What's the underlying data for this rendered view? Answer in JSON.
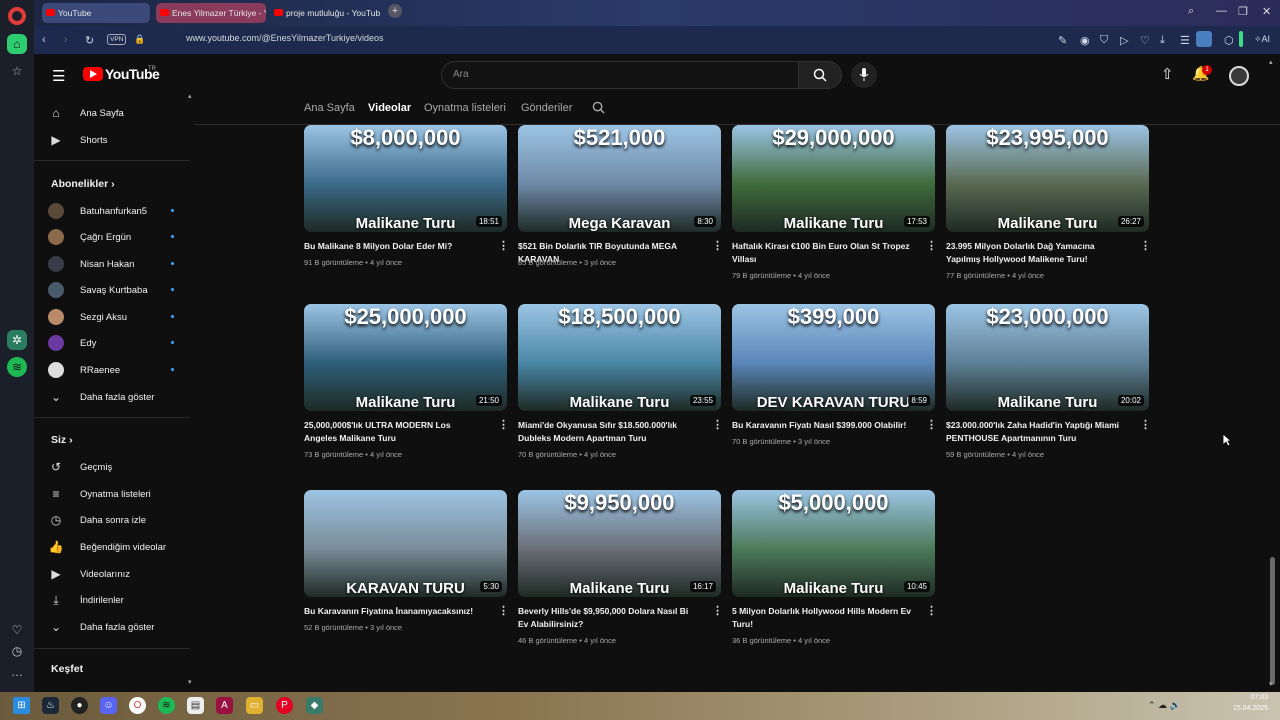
{
  "browser": {
    "tabs": [
      {
        "label": "YouTube",
        "active": true
      },
      {
        "label": "Enes Yilmazer Türkiye - Yo"
      },
      {
        "label": "proje mutluluğu - YouTub"
      }
    ],
    "url": "www.youtube.com/@EnesYilmazerTurkiye/videos",
    "vpn_label": "VPN",
    "ai_label": "AI"
  },
  "header": {
    "logo_text": "YouTube",
    "logo_region": "TR",
    "search_placeholder": "Ara",
    "notification_count": "1"
  },
  "sidebar": {
    "main": [
      {
        "label": "Ana Sayfa",
        "icon": "home-icon"
      },
      {
        "label": "Shorts",
        "icon": "shorts-icon"
      }
    ],
    "subscriptions_title": "Abonelikler",
    "subscriptions": [
      {
        "label": "Batuhanfurkan5"
      },
      {
        "label": "Çağrı Ergün"
      },
      {
        "label": "Nisan Hakan"
      },
      {
        "label": "Savaş Kurtbaba"
      },
      {
        "label": "Sezgi Aksu"
      },
      {
        "label": "Edy"
      },
      {
        "label": "RRaenee"
      }
    ],
    "show_more_1": "Daha fazla göster",
    "you_title": "Siz",
    "you": [
      {
        "label": "Geçmiş",
        "icon": "history-icon"
      },
      {
        "label": "Oynatma listeleri",
        "icon": "playlist-icon"
      },
      {
        "label": "Daha sonra izle",
        "icon": "clock-icon"
      },
      {
        "label": "Beğendiğim videolar",
        "icon": "thumbs-up-icon"
      },
      {
        "label": "Videolarınız",
        "icon": "video-icon"
      },
      {
        "label": "İndirilenler",
        "icon": "download-icon"
      }
    ],
    "show_more_2": "Daha fazla göster",
    "explore_title": "Keşfet"
  },
  "channel_tabs": [
    "Ana Sayfa",
    "Videolar",
    "Oynatma listeleri",
    "Gönderiler"
  ],
  "videos": [
    {
      "price": "$8,000,000",
      "tag": "Malikane Turu",
      "duration": "18:51",
      "title": "Bu Malikane 8 Milyon Dolar Eder Mi?",
      "meta": "91 B görüntüleme • 4 yıl önce",
      "color": "#3c6b8a"
    },
    {
      "price": "$521,000",
      "tag": "Mega Karavan",
      "duration": "8:30",
      "title": "$521 Bin Dolarlık TIR Boyutunda MEGA KARAVAN",
      "meta": "85 B görüntüleme • 3 yıl önce",
      "color": "#6f8aa8"
    },
    {
      "price": "$29,000,000",
      "tag": "Malikane Turu",
      "duration": "17:53",
      "title": "Haftalık Kirası €100 Bin Euro Olan St Tropez Villası",
      "meta": "79 B görüntüleme • 4 yıl önce",
      "color": "#3f6b3c"
    },
    {
      "price": "$23,995,000",
      "tag": "Malikane Turu",
      "duration": "26:27",
      "title": "23.995 Milyon Dolarlık Dağ Yamacına Yapılmış Hollywood Malikene Turu!",
      "meta": "77 B görüntüleme • 4 yıl önce",
      "color": "#5a6a52"
    },
    {
      "price": "$25,000,000",
      "tag": "Malikane Turu",
      "duration": "21:50",
      "title": "25,000,000$'lık ULTRA MODERN Los Angeles Malikane Turu",
      "meta": "73 B görüntüleme • 4 yıl önce",
      "color": "#2f5f7a"
    },
    {
      "price": "$18,500,000",
      "tag": "Malikane Turu",
      "duration": "23:55",
      "title": "Miami'de Okyanusa Sıfır $18.500.000'lık Dubleks Modern Apartman Turu",
      "meta": "70 B görüntüleme • 4 yıl önce",
      "color": "#4a87a6"
    },
    {
      "price": "$399,000",
      "tag": "DEV KARAVAN TURU",
      "duration": "8:59",
      "title": "Bu Karavanın Fiyatı Nasıl $399.000 Olabilir!",
      "meta": "70 B görüntüleme • 3 yıl önce",
      "color": "#5b86b8"
    },
    {
      "price": "$23,000,000",
      "tag": "Malikane Turu",
      "duration": "20:02",
      "title": "$23.000.000'lık Zaha Hadid'in Yaptığı Miami PENTHOUSE Apartmanının Turu",
      "meta": "59 B görüntüleme • 4 yıl önce",
      "color": "#5e8096"
    },
    {
      "price": "",
      "tag": "KARAVAN TURU",
      "duration": "5:30",
      "title": "Bu Karavanın Fiyatına İnanamıyacaksınız!",
      "meta": "52 B görüntüleme • 3 yıl önce",
      "color": "#7a8c99"
    },
    {
      "price": "$9,950,000",
      "tag": "Malikane Turu",
      "duration": "16:17",
      "title": "Beverly Hills'de $9,950,000 Dolara Nasıl Bi Ev Alabilirsiniz?",
      "meta": "46 B görüntüleme • 4 yıl önce",
      "color": "#6a6f78"
    },
    {
      "price": "$5,000,000",
      "tag": "Malikane Turu",
      "duration": "10:45",
      "title": "5 Milyon Dolarlık Hollywood Hills Modern Ev Turu!",
      "meta": "36 B görüntüleme • 4 yıl önce",
      "color": "#4d7a5a"
    }
  ],
  "taskbar": {
    "time": "07:03",
    "date": "15.04.2025"
  }
}
